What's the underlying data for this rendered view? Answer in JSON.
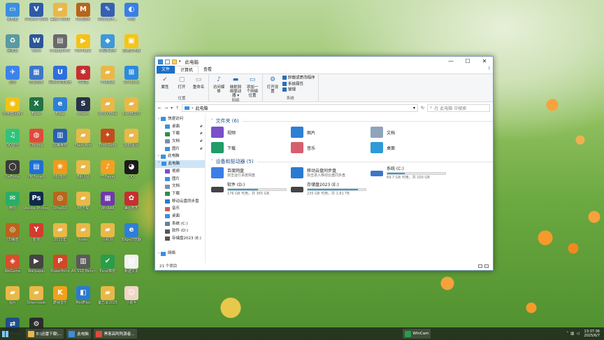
{
  "desktop": {
    "icons": [
      {
        "label": "此电脑",
        "color": "#3b8fe0",
        "glyph": "▭"
      },
      {
        "label": "VMware Workstati...",
        "color": "#2d5aa8",
        "glyph": "V"
      },
      {
        "label": "美腾了2028",
        "color": "#e9b849",
        "glyph": "▰"
      },
      {
        "label": "Mod助手",
        "color": "#b8651d",
        "glyph": "M"
      },
      {
        "label": "Microsoft...",
        "color": "#3660b5",
        "glyph": "✎"
      },
      {
        "label": "哔哩",
        "color": "#3b7fe6",
        "glyph": "◐"
      },
      {
        "label": "回收站",
        "color": "#5a9aa0",
        "glyph": "♻"
      },
      {
        "label": "Word",
        "color": "#2b579a",
        "glyph": "W"
      },
      {
        "label": "ChipSplitter",
        "color": "#6a6a6a",
        "glyph": "▤"
      },
      {
        "label": "PotPlayer",
        "color": "#f4c319",
        "glyph": "▶"
      },
      {
        "label": "小程序助手",
        "color": "#4098d8",
        "glyph": "◆"
      },
      {
        "label": "雷电多开器",
        "color": "#f5c518",
        "glyph": "▣"
      },
      {
        "label": "迅雷",
        "color": "#3c83ea",
        "glyph": "✈"
      },
      {
        "label": "控制面板",
        "color": "#3d76c7",
        "glyph": "▦"
      },
      {
        "label": "网易UU加速器",
        "color": "#2f6fdc",
        "glyph": "U"
      },
      {
        "label": "小黑盒",
        "color": "#c53030",
        "glyph": "✱"
      },
      {
        "label": "PS2游戏",
        "color": "#e9b849",
        "glyph": "▰"
      },
      {
        "label": "Windows",
        "color": "#2d8ae0",
        "glyph": "⊞"
      },
      {
        "label": "雷电模拟器9",
        "color": "#f2c21b",
        "glyph": "◉"
      },
      {
        "label": "Excel",
        "color": "#217346",
        "glyph": "X"
      },
      {
        "label": "Edge",
        "color": "#2f7fd4",
        "glyph": "e"
      },
      {
        "label": "Steam",
        "color": "#26334a",
        "glyph": "S"
      },
      {
        "label": "WPS Office",
        "color": "#e9b849",
        "glyph": "▰"
      },
      {
        "label": "1.4MB文件",
        "color": "#e9b849",
        "glyph": "▰"
      },
      {
        "label": "QQ音乐",
        "color": "#31c27c",
        "glyph": "♫"
      },
      {
        "label": "Chrome",
        "color": "#e04a3b",
        "glyph": "◍"
      },
      {
        "label": "完美世界",
        "color": "#2a5fb0",
        "glyph": "▥"
      },
      {
        "label": "Flash Aim",
        "color": "#e9b849",
        "glyph": "▰"
      },
      {
        "label": "TorchLight",
        "color": "#c54b1b",
        "glyph": "✦"
      },
      {
        "label": "WPS图片",
        "color": "#e9b849",
        "glyph": "▰"
      },
      {
        "label": "GeForce",
        "color": "#3a3a3a",
        "glyph": "◯"
      },
      {
        "label": "HP Smart",
        "color": "#1f6fd6",
        "glyph": "▤"
      },
      {
        "label": "360软件",
        "color": "#f19a1a",
        "glyph": "❀"
      },
      {
        "label": "Bili小鼠",
        "color": "#e9b849",
        "glyph": "▰"
      },
      {
        "label": "TTPlayer",
        "color": "#f5a021",
        "glyph": "♪"
      },
      {
        "label": "QQ",
        "color": "#1b1b1b",
        "glyph": "◕"
      },
      {
        "label": "微信",
        "color": "#2aae67",
        "glyph": "✉"
      },
      {
        "label": "Adobe Photoshop",
        "color": "#0e2a4a",
        "glyph": "Ps"
      },
      {
        "label": "UltraISO",
        "color": "#b8651d",
        "glyph": "◎"
      },
      {
        "label": "BT下载",
        "color": "#e9b849",
        "glyph": "▰"
      },
      {
        "label": "WinRAR",
        "color": "#6f3aa8",
        "glyph": "▦"
      },
      {
        "label": "美图秀秀",
        "color": "#c53030",
        "glyph": "✿"
      },
      {
        "label": "CD播放",
        "color": "#b8651d",
        "glyph": "◎"
      },
      {
        "label": "有道",
        "color": "#d33b2e",
        "glyph": "Y"
      },
      {
        "label": "2023年",
        "color": "#e9b849",
        "glyph": "▰"
      },
      {
        "label": "hosts",
        "color": "#e9b849",
        "glyph": "▰"
      },
      {
        "label": "小红书",
        "color": "#e9b849",
        "glyph": "▰"
      },
      {
        "label": "Edge浏览器",
        "color": "#2f7fd4",
        "glyph": "e"
      },
      {
        "label": "WeGame",
        "color": "#d84e2e",
        "glyph": "◈"
      },
      {
        "label": "Wallpaper",
        "color": "#444",
        "glyph": "▶"
      },
      {
        "label": "PowerPoint",
        "color": "#d24726",
        "glyph": "P"
      },
      {
        "label": "AS SSD Benchmark",
        "color": "#5a5a5a",
        "glyph": "▥"
      },
      {
        "label": "Excel数据",
        "color": "#2a9d4a",
        "glyph": "✔"
      },
      {
        "label": "新建文本",
        "color": "#f2f2f2",
        "glyph": "▤"
      },
      {
        "label": "图片",
        "color": "#e9b849",
        "glyph": "▰"
      },
      {
        "label": "Downloads",
        "color": "#e9b849",
        "glyph": "▰"
      },
      {
        "label": "酷我音乐",
        "color": "#f3a01c",
        "glyph": "K"
      },
      {
        "label": "ModFiles",
        "color": "#2a7ad1",
        "glyph": "◧"
      },
      {
        "label": "备忘录2025",
        "color": "#e9b849",
        "glyph": "▰"
      },
      {
        "label": "小助手",
        "color": "#f0d5c8",
        "glyph": "☺"
      },
      {
        "label": "TeamViewer",
        "color": "#1e4e8c",
        "glyph": "⇄"
      },
      {
        "label": "CheatEngine",
        "color": "#2c2c2c",
        "glyph": "⚙"
      }
    ]
  },
  "window": {
    "title": "此电脑",
    "controls": {
      "min": "—",
      "max": "☐",
      "close": "✕"
    },
    "tabs": [
      "文件",
      "计算机",
      "查看"
    ],
    "help": "?",
    "ribbon": {
      "groups": [
        {
          "label": "位置",
          "buttons": [
            {
              "label": "属性",
              "glyph": "✓",
              "color": "#d23"
            },
            {
              "label": "打开",
              "glyph": "▢",
              "color": "#888"
            },
            {
              "label": "重命名",
              "glyph": "▭",
              "color": "#888"
            }
          ]
        },
        {
          "label": "网络",
          "buttons": [
            {
              "label": "访问媒体",
              "glyph": "♪",
              "color": "#2a6fb7"
            },
            {
              "label": "映射网络驱动器 ▾",
              "glyph": "▬",
              "color": "#2a6fb7"
            },
            {
              "label": "添加一个网络位置",
              "glyph": "▭",
              "color": "#2a6fb7"
            }
          ]
        },
        {
          "label": "系统",
          "buttons": [
            {
              "label": "打开设置",
              "glyph": "⚙",
              "color": "#2a6fb7"
            }
          ],
          "small": [
            "卸载或更改程序",
            "系统属性",
            "管理"
          ]
        }
      ]
    },
    "address": {
      "path": "此电脑",
      "search_placeholder": "在 此电脑 中搜索"
    },
    "nav": [
      {
        "label": "快速访问",
        "color": "#3b8fe0",
        "indent": 0,
        "pin": false
      },
      {
        "label": "桌面",
        "color": "#3b8fe0",
        "indent": 1,
        "pin": true
      },
      {
        "label": "下载",
        "color": "#2c8f4e",
        "indent": 1,
        "pin": true
      },
      {
        "label": "文档",
        "color": "#7a8ea8",
        "indent": 1,
        "pin": true
      },
      {
        "label": "图片",
        "color": "#3b8fe0",
        "indent": 1,
        "pin": true
      },
      {
        "label": "此电脑",
        "color": "#3b8fe0",
        "indent": 0,
        "pin": false
      },
      {
        "label": "此电脑",
        "color": "#3b8fe0",
        "indent": 0,
        "pin": false,
        "selected": true
      },
      {
        "label": "视频",
        "color": "#7a4fc9",
        "indent": 1,
        "pin": false
      },
      {
        "label": "图片",
        "color": "#3b8fe0",
        "indent": 1,
        "pin": false
      },
      {
        "label": "文档",
        "color": "#7a8ea8",
        "indent": 1,
        "pin": false
      },
      {
        "label": "下载",
        "color": "#2c8f4e",
        "indent": 1,
        "pin": false
      },
      {
        "label": "移动云盘同步盘",
        "color": "#2a7ad1",
        "indent": 1,
        "pin": false
      },
      {
        "label": "音乐",
        "color": "#d05a5a",
        "indent": 1,
        "pin": false
      },
      {
        "label": "桌面",
        "color": "#3b8fe0",
        "indent": 1,
        "pin": false
      },
      {
        "label": "系统 (C:)",
        "color": "#6a7f96",
        "indent": 1,
        "pin": false
      },
      {
        "label": "软件 (D:)",
        "color": "#555",
        "indent": 1,
        "pin": false
      },
      {
        "label": "存储盘2023 (E:)",
        "color": "#555",
        "indent": 1,
        "pin": false
      },
      {
        "label": "",
        "color": "transparent",
        "indent": 0,
        "pin": false
      },
      {
        "label": "网络",
        "color": "#3b8fe0",
        "indent": 0,
        "pin": false
      }
    ],
    "folders_header": "文件夹 (6)",
    "folders": [
      {
        "label": "视频",
        "color": "#7a4fc9"
      },
      {
        "label": "图片",
        "color": "#2f7fd4"
      },
      {
        "label": "文档",
        "color": "#8fa3bd"
      },
      {
        "label": "下载",
        "color": "#1f9c6a"
      },
      {
        "label": "音乐",
        "color": "#d65f6f"
      },
      {
        "label": "桌面",
        "color": "#2f9ad8"
      }
    ],
    "devices_header": "设备和驱动器 (5)",
    "devices": [
      {
        "name": "百度网盘",
        "sub": "双击运行百度网盘",
        "color": "#3a7ee8",
        "bar": false
      },
      {
        "name": "移动云盘同步盘",
        "sub": "双击进入移动云盘同步盘",
        "color": "#2a7ad1",
        "bar": false
      },
      {
        "name": "系统 (C:)",
        "sub": "69.7 GB 可用，共 100 GB",
        "color": "#3d76c7",
        "bar": true,
        "used": 0.3
      },
      {
        "name": "软件 (D:)",
        "sub": "176 GB 可用，共 365 GB",
        "color": "#444",
        "bar": true,
        "used": 0.52
      },
      {
        "name": "存储盘2023 (E:)",
        "sub": "235 GB 可用，共 1.81 TB",
        "color": "#444",
        "bar": true,
        "used": 0.87
      }
    ],
    "status": "21 个项目"
  },
  "taskbar": {
    "items": [
      {
        "label": "E:\\迅雷下载\\...",
        "color": "#e9b849"
      },
      {
        "label": "此电脑",
        "color": "#3b8fe0"
      },
      {
        "label": "黑客高阿阿源者...",
        "color": "#e04a3b"
      },
      {
        "label": "WinCam",
        "color": "#2a9d4a"
      }
    ],
    "clock": {
      "time": "13:37:36",
      "date": "2025/6/7"
    }
  }
}
